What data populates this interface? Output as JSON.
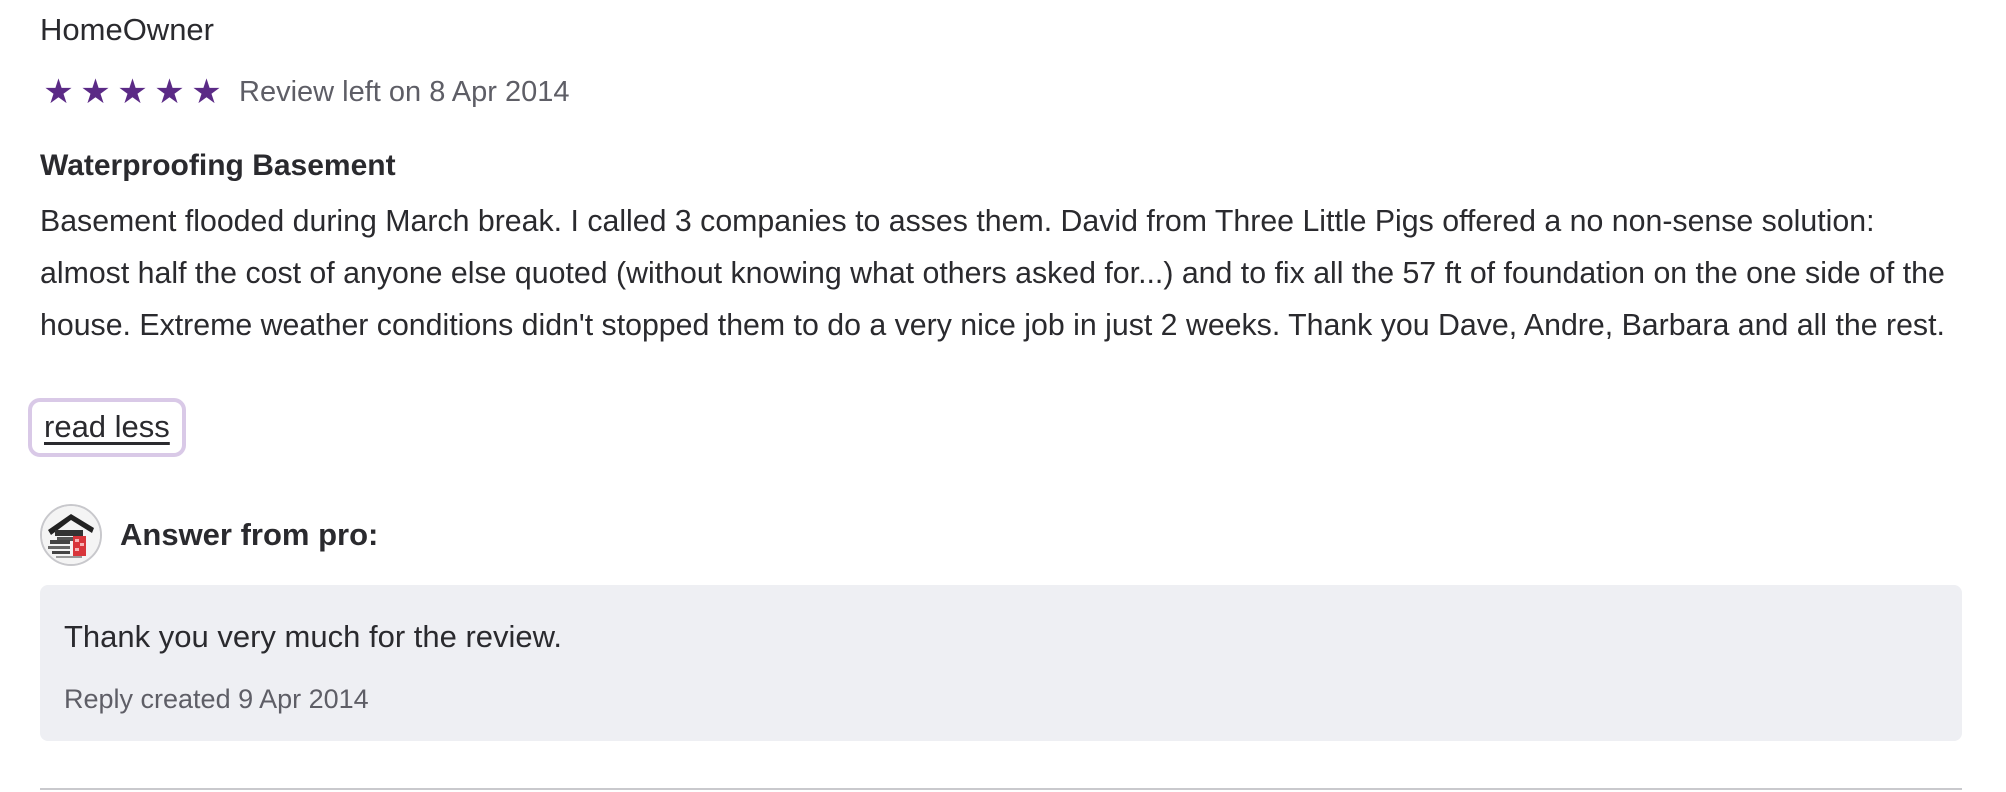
{
  "review": {
    "author": "HomeOwner",
    "rating": 5,
    "rating_max": 5,
    "star_glyph": "★",
    "star_color": "#5b2a86",
    "date_text": "Review left on 8 Apr 2014",
    "title": "Waterproofing Basement",
    "body": "Basement flooded during March break. I called 3 companies to asses them. David from Three Little Pigs offered a no non-sense solution: almost half the cost of anyone else quoted (without knowing what others asked for...) and to fix all the 57 ft of foundation on the one side of the house. Extreme weather conditions didn't stopped them to do a very nice job in just 2 weeks. Thank you Dave, Andre, Barbara and all the rest.",
    "toggle_label": "read less"
  },
  "answer": {
    "avatar_icon": "pro-logo-avatar",
    "label": "Answer from pro:",
    "text": "Thank you very much for the review.",
    "date_text": "Reply created 9 Apr 2014",
    "box_color": "#eeeff3"
  }
}
